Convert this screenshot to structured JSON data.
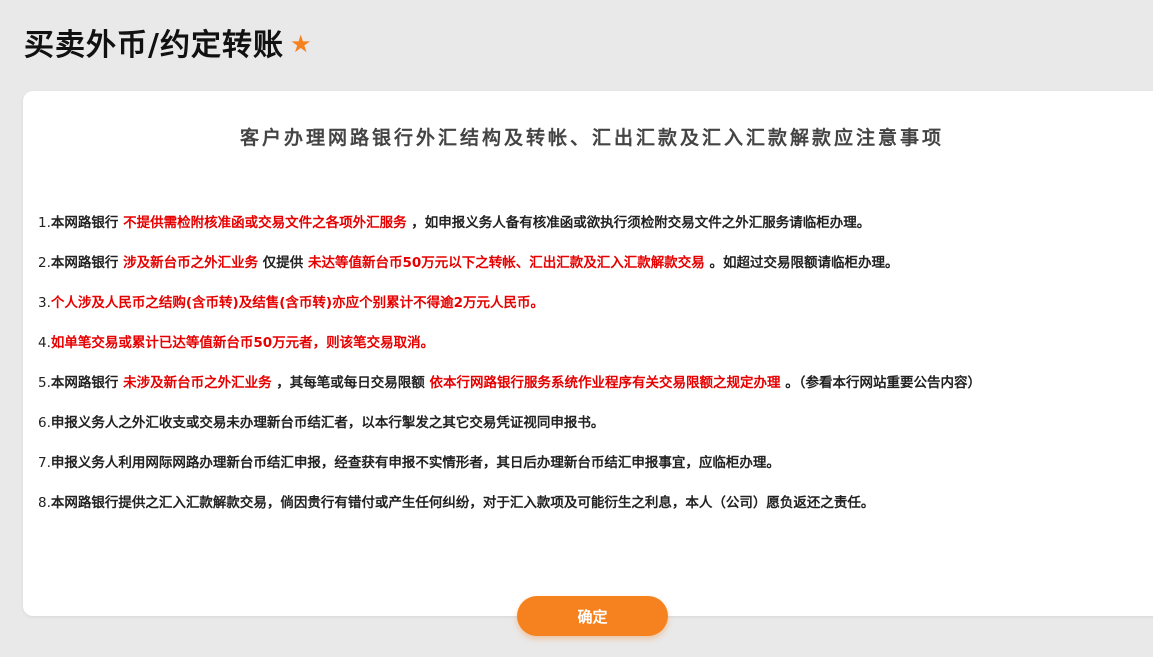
{
  "header": {
    "title": "买卖外币/约定转账",
    "star_icon": "★",
    "accent_color": "#f5821f"
  },
  "notice": {
    "title": "客户办理网路银行外汇结构及转帐、汇出汇款及汇入汇款解款应注意事项",
    "highlight_color": "#e60000",
    "items": [
      {
        "num": "1.",
        "parts": [
          "本网路银行 ",
          "不提供需检附核准函或交易文件之各项外汇服务",
          " ，如申报义务人备有核准函或欲执行须检附交易文件之外汇服务请临柜办理。"
        ]
      },
      {
        "num": "2.",
        "parts": [
          "本网路银行 ",
          "涉及新台币之外汇业务",
          " 仅提供 ",
          "未达等值新台币50万元以下之转帐、汇出汇款及汇入汇款解款交易",
          " 。如超过交易限额请临柜办理。"
        ]
      },
      {
        "num": "3.",
        "parts": [
          "个人涉及人民币之结购(含币转)及结售(含币转)亦应个别累计不得逾2万元人民币。"
        ]
      },
      {
        "num": "4.",
        "parts": [
          "如单笔交易或累计已达等值新台币50万元者，则该笔交易取消。"
        ]
      },
      {
        "num": "5.",
        "parts": [
          "本网路银行 ",
          "未涉及新台币之外汇业务",
          " ，其每笔或每日交易限额 ",
          "依本行网路银行服务系统作业程序有关交易限额之规定办理",
          " 。（参看本行网站重要公告内容）"
        ]
      },
      {
        "num": "6.",
        "parts": [
          "申报义务人之外汇收支或交易未办理新台币结汇者，以本行掣发之其它交易凭证视同申报书。"
        ]
      },
      {
        "num": "7.",
        "parts": [
          "申报义务人利用网际网路办理新台币结汇申报，经查获有申报不实情形者，其日后办理新台币结汇申报事宜，应临柜办理。"
        ]
      },
      {
        "num": "8.",
        "parts": [
          "本网路银行提供之汇入汇款解款交易，倘因贵行有错付或产生任何纠纷，对于汇入款项及可能衍生之利息，本人（公司）愿负返还之责任。"
        ]
      }
    ]
  },
  "actions": {
    "confirm_label": "确定"
  }
}
